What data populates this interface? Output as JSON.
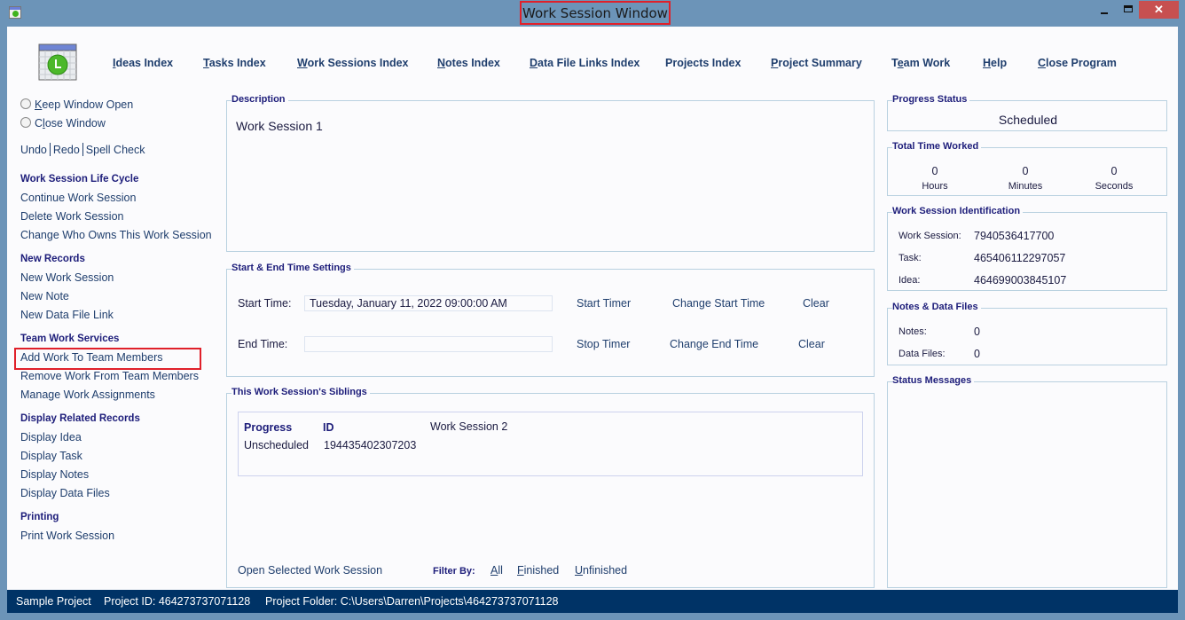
{
  "window": {
    "title": "Work Session Window",
    "close_glyph": "✕"
  },
  "nav": {
    "items": [
      {
        "mnemonic": "I",
        "rest": "deas Index"
      },
      {
        "mnemonic": "T",
        "rest": "asks Index"
      },
      {
        "mnemonic": "W",
        "rest": "ork Sessions Index"
      },
      {
        "mnemonic": "N",
        "rest": "otes Index"
      },
      {
        "mnemonic": "D",
        "rest": "ata File Links Index"
      },
      {
        "mnemonic": "",
        "rest": "Projects Index"
      },
      {
        "mnemonic": "P",
        "rest": "roject Summary"
      },
      {
        "pre": "T",
        "mnemonic": "e",
        "rest": "am Work"
      },
      {
        "mnemonic": "H",
        "rest": "elp"
      },
      {
        "mnemonic": "C",
        "rest": "lose Program"
      }
    ]
  },
  "left": {
    "keep_open": {
      "mnemonic": "K",
      "rest": "eep Window Open"
    },
    "close_window": {
      "pre": "C",
      "mnemonic": "l",
      "rest": "ose Window"
    },
    "undo": "Undo",
    "redo": "Redo",
    "spell_check": "Spell Check",
    "sections": [
      {
        "heading": "Work Session Life Cycle",
        "items": [
          "Continue Work Session",
          "Delete Work Session",
          "Change Who Owns This Work Session"
        ]
      },
      {
        "heading": "New Records",
        "items": [
          "New Work Session",
          "New Note",
          "New Data File Link"
        ]
      },
      {
        "heading": "Team Work Services",
        "items": [
          "Add Work To Team Members",
          "Remove Work From Team Members",
          "Manage Work Assignments"
        ]
      },
      {
        "heading": "Display Related Records",
        "items": [
          "Display Idea",
          "Display Task",
          "Display Notes",
          "Display Data Files"
        ]
      },
      {
        "heading": "Printing",
        "items": [
          "Print Work Session"
        ]
      }
    ]
  },
  "description": {
    "title": "Description",
    "value": "Work Session 1"
  },
  "time_settings": {
    "title": "Start & End Time Settings",
    "start_label": "Start Time:",
    "start_value": "Tuesday, January 11, 2022   09:00:00 AM",
    "start_timer": "Start Timer",
    "change_start": "Change Start Time",
    "clear_start": "Clear",
    "end_label": "End Time:",
    "end_value": "",
    "stop_timer": "Stop Timer",
    "change_end": "Change End Time",
    "clear_end": "Clear"
  },
  "siblings": {
    "title": "This Work Session's Siblings",
    "headers": {
      "progress": "Progress",
      "id": "ID"
    },
    "rows": [
      {
        "progress": "Unscheduled",
        "id": "194435402307203",
        "name": "Work Session 2"
      }
    ],
    "open_selected": "Open Selected Work Session",
    "filter_label": "Filter By:",
    "filters": [
      {
        "mnemonic": "A",
        "rest": "ll"
      },
      {
        "mnemonic": "F",
        "rest": "inished"
      },
      {
        "mnemonic": "U",
        "rest": "nfinished"
      }
    ]
  },
  "progress_status": {
    "title": "Progress Status",
    "value": "Scheduled"
  },
  "time_worked": {
    "title": "Total Time Worked",
    "hours": "0",
    "hours_label": "Hours",
    "minutes": "0",
    "minutes_label": "Minutes",
    "seconds": "0",
    "seconds_label": "Seconds"
  },
  "identification": {
    "title": "Work Session Identification",
    "work_session_label": "Work Session:",
    "work_session_id": "7940536417700",
    "task_label": "Task:",
    "task_id": "465406112297057",
    "idea_label": "Idea:",
    "idea_id": "464699003845107"
  },
  "notes_files": {
    "title": "Notes & Data Files",
    "notes_label": "Notes:",
    "notes_count": "0",
    "files_label": "Data Files:",
    "files_count": "0"
  },
  "status_messages": {
    "title": "Status Messages"
  },
  "statusbar": {
    "project": "Sample Project",
    "project_id": "Project ID:  464273737071128",
    "project_folder": "Project Folder: C:\\Users\\Darren\\Projects\\464273737071128"
  },
  "colors": {
    "accent_red": "#e0202a",
    "status_bar": "#003366",
    "frame": "#6c94b8"
  }
}
